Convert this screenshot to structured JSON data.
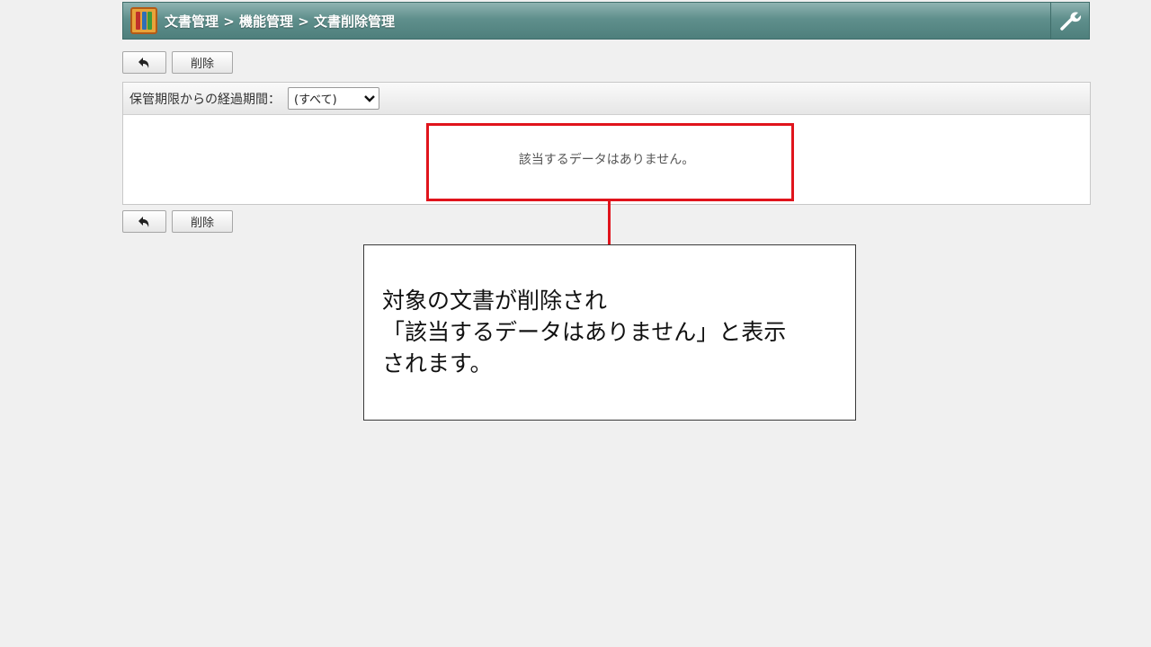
{
  "header": {
    "breadcrumb": "文書管理 > 機能管理 > 文書削除管理",
    "accent_color": "#5f8f8c",
    "app_icon": "binders-icon",
    "tool_icon": "wrench-icon"
  },
  "toolbar_top": {
    "back_icon": "undo-arrow-icon",
    "delete_label": "削除"
  },
  "filter": {
    "label": "保管期限からの経過期間：",
    "selected": "(すべて)"
  },
  "table": {
    "empty_message": "該当するデータはありません。"
  },
  "toolbar_bottom": {
    "back_icon": "undo-arrow-icon",
    "delete_label": "削除"
  },
  "annotation": {
    "text": "対象の文書が削除され\n「該当するデータはありません」と表示\nされます。",
    "highlight_color": "#e0141c"
  }
}
